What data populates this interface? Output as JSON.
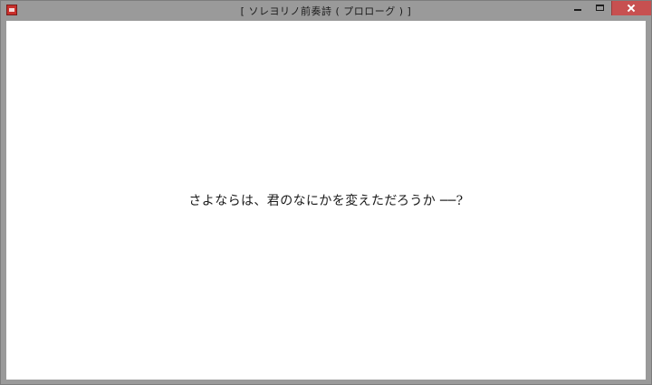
{
  "window": {
    "title": "[ ソレヨリノ前奏詩 ( プロローグ ) ]",
    "app_icon": "app-icon",
    "controls": {
      "minimize": "minimize-icon",
      "maximize": "maximize-icon",
      "close": "close-icon"
    }
  },
  "content": {
    "line": "さよならは、君のなにかを変えただろうか ──?"
  },
  "colors": {
    "frame": "#9a9a9a",
    "close_button": "#c75050",
    "background": "#ffffff",
    "text": "#1a1a1a"
  }
}
